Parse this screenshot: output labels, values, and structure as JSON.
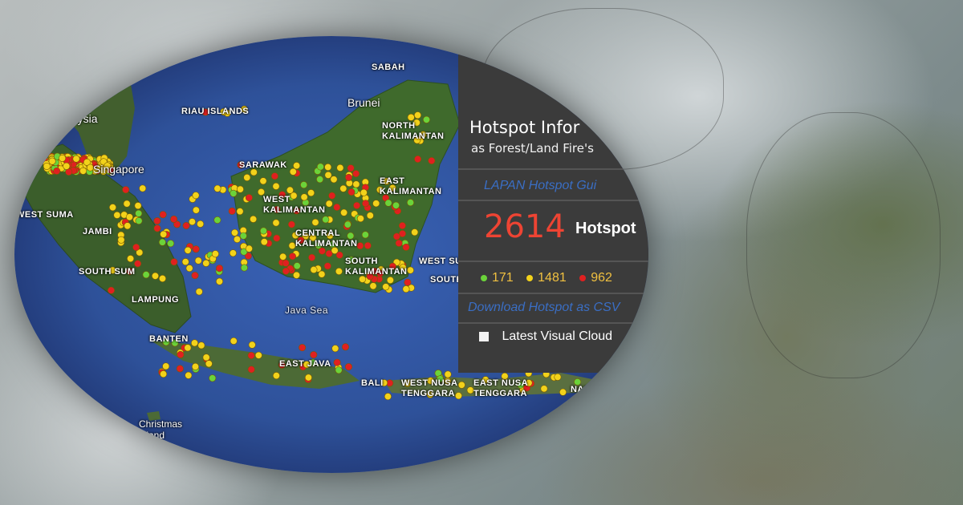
{
  "panel": {
    "title": "Hotspot Infor",
    "subtitle": "as Forest/Land Fire's",
    "guide_link": "LAPAN Hotspot Gui",
    "total_count": "2614",
    "count_label": "Hotspot",
    "legend": [
      {
        "value": "171",
        "color": "#6bd33a"
      },
      {
        "value": "1481",
        "color": "#f2d21b"
      },
      {
        "value": "962",
        "color": "#e02020"
      }
    ],
    "download_link": "Download Hotspot as CSV",
    "cloud_label": "Latest Visual Cloud"
  },
  "map": {
    "labels": {
      "sabah": "SABAH",
      "brunei": "Brunei",
      "north_kalimantan": "NORTH\nKALIMANTAN",
      "malaysia": "alaysia",
      "riau_islands": "RIAU ISLANDS",
      "singapore": "Singapore",
      "sarawak": "SARAWAK",
      "east_kalimantan": "EAST\nKALIMANTAN",
      "west_kalimantan": "WEST\nKALIMANTAN",
      "central_kalimantan": "CENTRAL\nKALIMANTAN",
      "south_kalimantan": "SOUTH\nKALIMANTAN",
      "west_sumatra": "WEST SUMA",
      "jambi": "JAMBI",
      "south_sumatra": "SOUTH SUM",
      "lampung": "LAMPUNG",
      "banten": "BANTEN",
      "java_sea": "Java Sea",
      "east_java": "EAST JAVA",
      "bali": "BALI",
      "west_nusa_tenggara": "WEST NUSA\nTENGGARA",
      "east_nusa_tenggara": "EAST NUSA\nTENGGARA",
      "christmas_island": "Christmas\nIsland",
      "west_su": "WEST SU",
      "south_su": "SOUTH SU",
      "nan": "NAN"
    }
  }
}
